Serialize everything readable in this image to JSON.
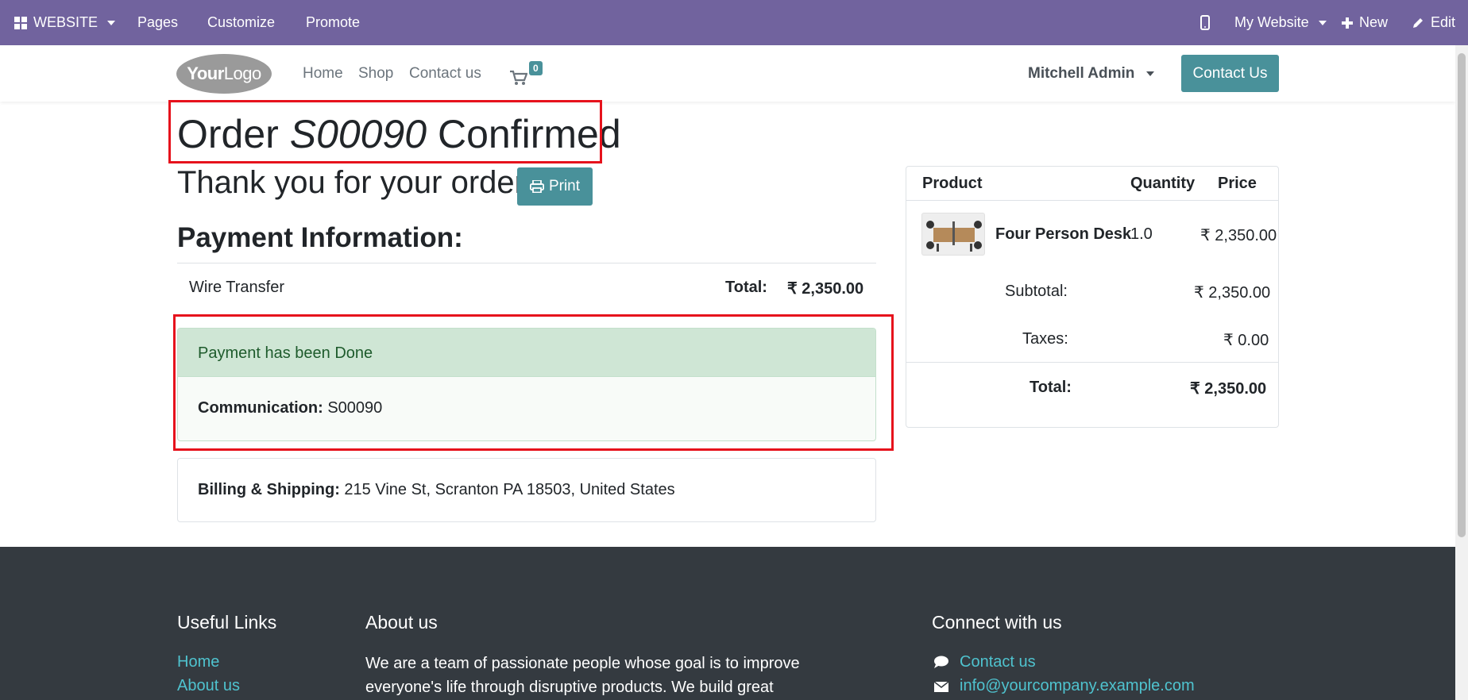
{
  "adminbar": {
    "website_label": "WEBSITE",
    "pages": "Pages",
    "customize": "Customize",
    "promote": "Promote",
    "my_website": "My Website",
    "new": "New",
    "edit": "Edit"
  },
  "header": {
    "logo_bold": "Your",
    "logo_light": "Logo",
    "nav": [
      "Home",
      "Shop",
      "Contact us"
    ],
    "cart_count": "0",
    "user": "Mitchell Admin",
    "contact_button": "Contact Us"
  },
  "order": {
    "title_prefix": "Order",
    "order_number": "S00090",
    "title_suffix": "Confirmed",
    "thanks": "Thank you for your order.",
    "print": "Print",
    "payment_heading": "Payment Information:",
    "payment_method": "Wire Transfer",
    "total_label": "Total:",
    "total_value": "₹ 2,350.00",
    "alert_text": "Payment has been Done",
    "communication_label": "Communication:",
    "communication_value": "S00090",
    "billing_label": "Billing & Shipping:",
    "billing_value": "215 Vine St, Scranton PA 18503, United States"
  },
  "summary": {
    "col_product": "Product",
    "col_quantity": "Quantity",
    "col_price": "Price",
    "product_name": "Four Person Desk",
    "product_qty": "1.0",
    "product_price": "₹ 2,350.00",
    "subtotal_label": "Subtotal:",
    "subtotal_value": "₹ 2,350.00",
    "taxes_label": "Taxes:",
    "taxes_value": "₹ 0.00",
    "total_label": "Total:",
    "total_value": "₹ 2,350.00"
  },
  "footer": {
    "useful_links_heading": "Useful Links",
    "links": [
      "Home",
      "About us"
    ],
    "about_heading": "About us",
    "about_text": "We are a team of passionate people whose goal is to improve everyone's life through disruptive products. We build great",
    "connect_heading": "Connect with us",
    "contact_link": "Contact us",
    "email": "info@yourcompany.example.com"
  },
  "colors": {
    "admin_bar": "#71639e",
    "primary": "#49919a",
    "highlight": "#e6121c",
    "alert_bg": "#cfe6d5",
    "footer_bg": "#343a40",
    "footer_link": "#4fc3cf"
  }
}
